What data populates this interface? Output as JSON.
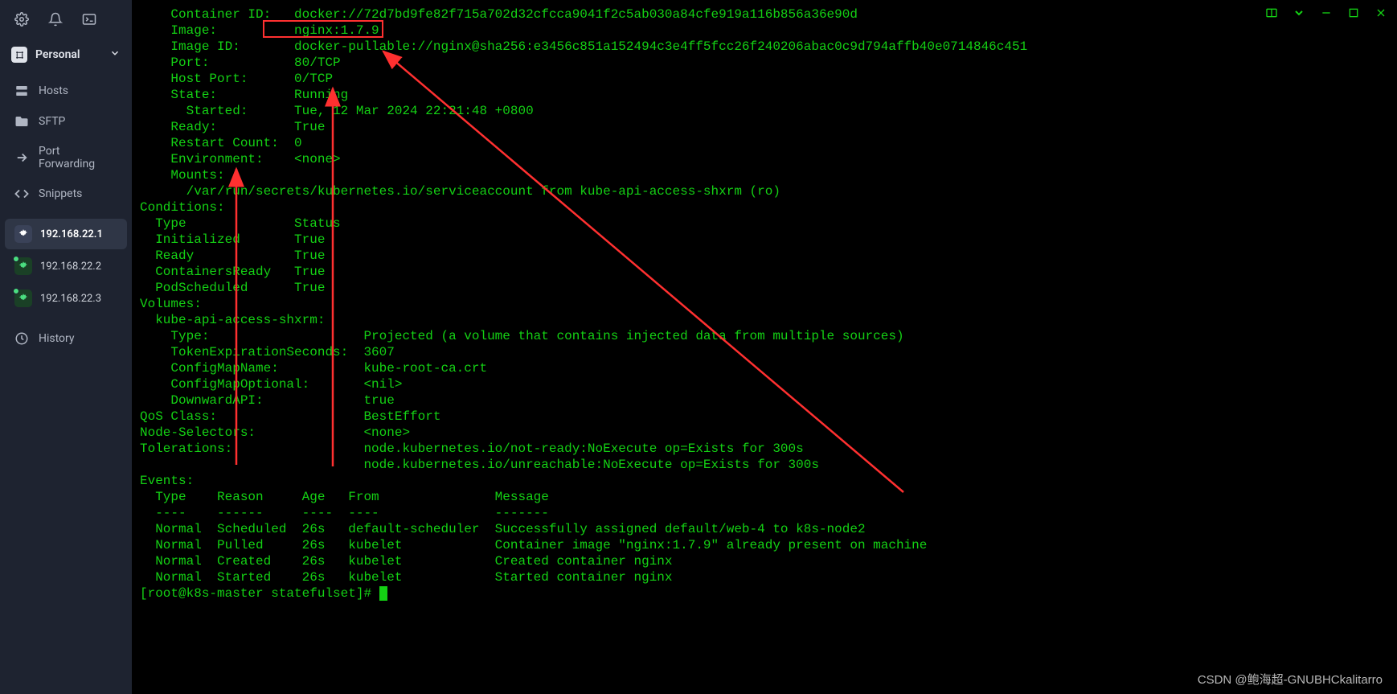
{
  "workspace": {
    "label": "Personal"
  },
  "nav": {
    "hosts": "Hosts",
    "sftp": "SFTP",
    "portfwd": "Port Forwarding",
    "snippets": "Snippets",
    "history": "History"
  },
  "connections": [
    {
      "ip": "192.168.22.1",
      "active": true,
      "online": false
    },
    {
      "ip": "192.168.22.2",
      "active": false,
      "online": true
    },
    {
      "ip": "192.168.22.3",
      "active": false,
      "online": true
    }
  ],
  "terminal": {
    "lines": [
      "    Container ID:   docker://72d7bd9fe82f715a702d32cfcca9041f2c5ab030a84cfe919a116b856a36e90d",
      "    Image:          nginx:1.7.9",
      "    Image ID:       docker-pullable://nginx@sha256:e3456c851a152494c3e4ff5fcc26f240206abac0c9d794affb40e0714846c451",
      "    Port:           80/TCP",
      "    Host Port:      0/TCP",
      "    State:          Running",
      "      Started:      Tue, 12 Mar 2024 22:21:48 +0800",
      "    Ready:          True",
      "    Restart Count:  0",
      "    Environment:    <none>",
      "    Mounts:",
      "      /var/run/secrets/kubernetes.io/serviceaccount from kube-api-access-shxrm (ro)",
      "Conditions:",
      "  Type              Status",
      "  Initialized       True ",
      "  Ready             True ",
      "  ContainersReady   True ",
      "  PodScheduled      True ",
      "Volumes:",
      "  kube-api-access-shxrm:",
      "    Type:                    Projected (a volume that contains injected data from multiple sources)",
      "    TokenExpirationSeconds:  3607",
      "    ConfigMapName:           kube-root-ca.crt",
      "    ConfigMapOptional:       <nil>",
      "    DownwardAPI:             true",
      "QoS Class:                   BestEffort",
      "Node-Selectors:              <none>",
      "Tolerations:                 node.kubernetes.io/not-ready:NoExecute op=Exists for 300s",
      "                             node.kubernetes.io/unreachable:NoExecute op=Exists for 300s",
      "Events:",
      "  Type    Reason     Age   From               Message",
      "  ----    ------     ----  ----               -------",
      "  Normal  Scheduled  26s   default-scheduler  Successfully assigned default/web-4 to k8s-node2",
      "  Normal  Pulled     26s   kubelet            Container image \"nginx:1.7.9\" already present on machine",
      "  Normal  Created    26s   kubelet            Created container nginx",
      "  Normal  Started    26s   kubelet            Started container nginx"
    ],
    "prompt": "[root@k8s-master statefulset]# "
  },
  "watermark": "CSDN @鲍海超-GNUBHCkalitarro"
}
